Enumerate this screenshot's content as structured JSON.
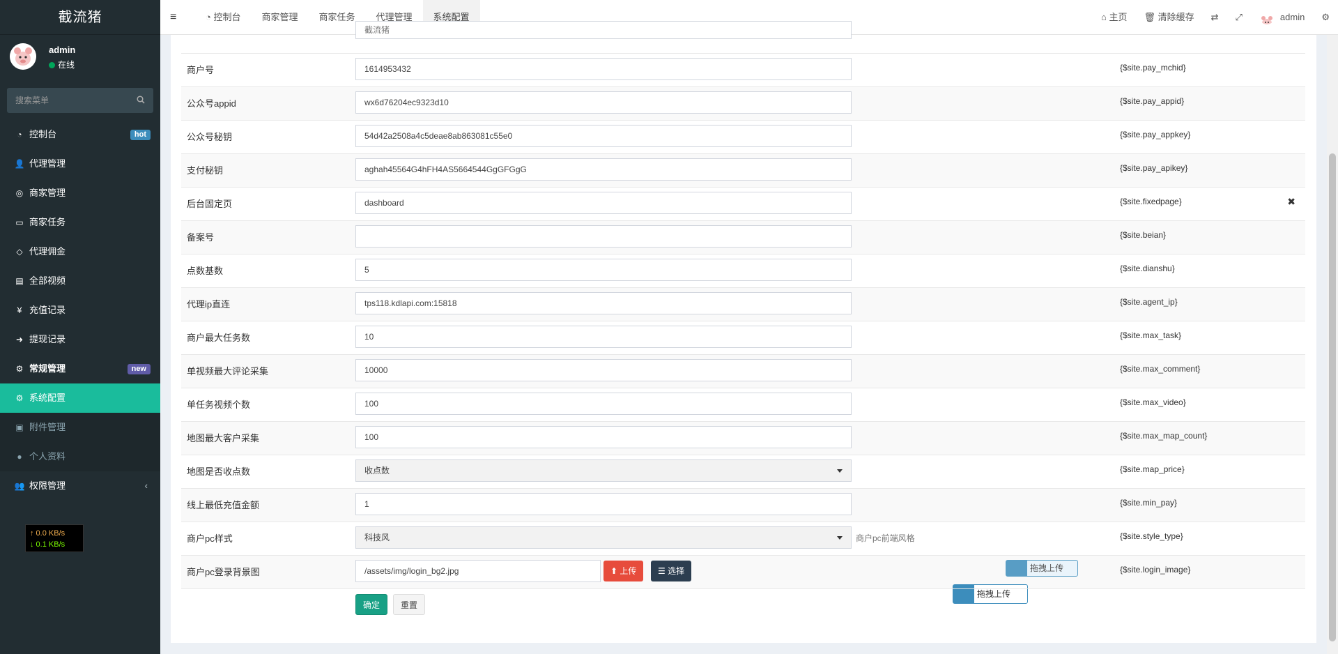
{
  "app": {
    "logo": "截流猪"
  },
  "user": {
    "name": "admin",
    "status": "在线"
  },
  "search": {
    "placeholder": "搜索菜单"
  },
  "menu": {
    "items": [
      {
        "label": "控制台",
        "badge": "hot"
      },
      {
        "label": "代理管理"
      },
      {
        "label": "商家管理"
      },
      {
        "label": "商家任务"
      },
      {
        "label": "代理佣金"
      },
      {
        "label": "全部视频"
      },
      {
        "label": "充值记录"
      },
      {
        "label": "提现记录"
      },
      {
        "label": "常规管理",
        "badge": "new"
      },
      {
        "label": "系统配置"
      },
      {
        "label": "附件管理"
      },
      {
        "label": "个人资料"
      },
      {
        "label": "权限管理"
      }
    ]
  },
  "netspeed": {
    "up": "↑ 0.0 KB/s",
    "down": "↓ 0.1 KB/s"
  },
  "topnav": {
    "tabs": [
      "控制台",
      "商家管理",
      "商家任务",
      "代理管理",
      "系统配置"
    ],
    "home": "主页",
    "clear_cache": "清除缓存",
    "user": "admin"
  },
  "form": {
    "top_partial_value": "截流猪",
    "rows": [
      {
        "label": "商户号",
        "value": "1614953432",
        "var": "{$site.pay_mchid}"
      },
      {
        "label": "公众号appid",
        "value": "wx6d76204ec9323d10",
        "var": "{$site.pay_appid}"
      },
      {
        "label": "公众号秘钥",
        "value": "54d42a2508a4c5deae8ab863081c55e0",
        "var": "{$site.pay_appkey}"
      },
      {
        "label": "支付秘钥",
        "value": "aghah45564G4hFH4AS5664544GgGFGgG",
        "var": "{$site.pay_apikey}"
      },
      {
        "label": "后台固定页",
        "value": "dashboard",
        "var": "{$site.fixedpage}"
      },
      {
        "label": "备案号",
        "value": "",
        "var": "{$site.beian}"
      },
      {
        "label": "点数基数",
        "value": "5",
        "var": "{$site.dianshu}"
      },
      {
        "label": "代理ip直连",
        "value": "tps118.kdlapi.com:15818",
        "var": "{$site.agent_ip}"
      },
      {
        "label": "商户最大任务数",
        "value": "10",
        "var": "{$site.max_task}"
      },
      {
        "label": "单视频最大评论采集",
        "value": "10000",
        "var": "{$site.max_comment}"
      },
      {
        "label": "单任务视频个数",
        "value": "100",
        "var": "{$site.max_video}"
      },
      {
        "label": "地图最大客户采集",
        "value": "100",
        "var": "{$site.max_map_count}"
      },
      {
        "label": "地图是否收点数",
        "value": "收点数",
        "var": "{$site.map_price}"
      },
      {
        "label": "线上最低充值金额",
        "value": "1",
        "var": "{$site.min_pay}"
      },
      {
        "label": "商户pc样式",
        "value": "科技风",
        "var": "{$site.style_type}",
        "hint": "商户pc前端风格"
      },
      {
        "label": "商户pc登录背景图",
        "value": "/assets/img/login_bg2.jpg",
        "var": "{$site.login_image}"
      }
    ],
    "upload": "上传",
    "choose": "选择",
    "drag_upload": "拖拽上传",
    "confirm": "确定",
    "reset": "重置"
  },
  "colors": {
    "accent": "#1abc9c",
    "sidebar": "#222d32",
    "upload": "#e74c3c",
    "choose": "#2c3e50",
    "confirm": "#18a085"
  }
}
